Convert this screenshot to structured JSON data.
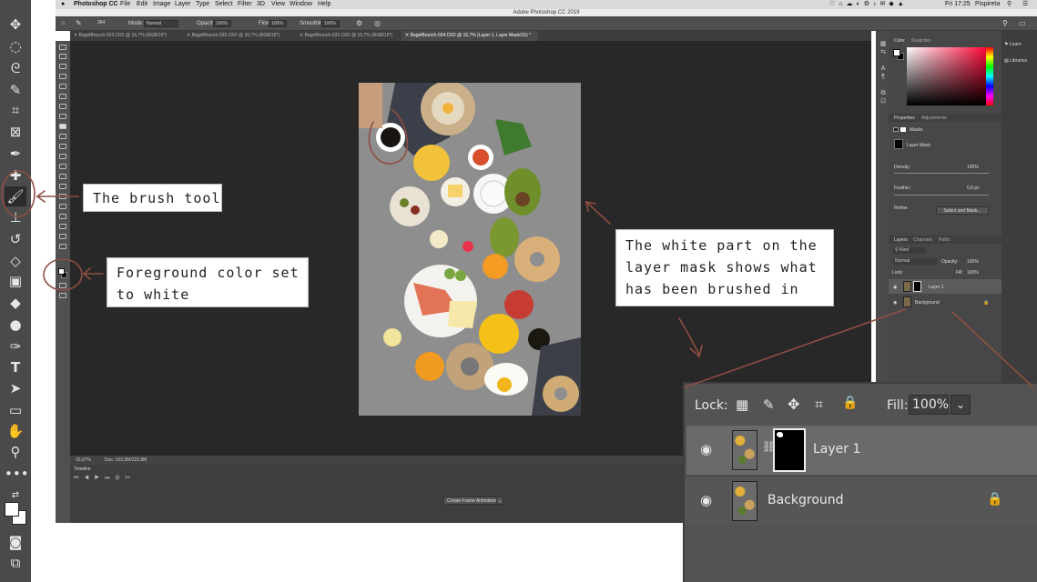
{
  "app": {
    "mac_menu": [
      "Photoshop CC",
      "File",
      "Edit",
      "Image",
      "Layer",
      "Type",
      "Select",
      "Filter",
      "3D",
      "View",
      "Window",
      "Help"
    ],
    "window_title": "Adobe Photoshop CC 2019",
    "clock": "Fri 17:25",
    "user": "Pispireta"
  },
  "options_bar": {
    "brush_size": "364",
    "mode_label": "Mode:",
    "mode_value": "Normal",
    "opacity_label": "Opacity:",
    "opacity_value": "100%",
    "flow_label": "Flow:",
    "flow_value": "100%",
    "smoothing_label": "Smoothing:",
    "smoothing_value": "100%"
  },
  "tabs": [
    "BagelBrunch-023.CR2 @ 16,7% (RGB/16*)",
    "BagelBrunch-030.CR2 @ 16,7% (RGB/16*)",
    "BagelBrunch-031.CR2 @ 16,7% (RGB/16*)",
    "BagelBrunch-034.CR2 @ 16,7% (Layer 1, Layer Mask/16) *"
  ],
  "status": {
    "zoom": "16,67%",
    "doc": "Doc: 102,5M/222,8M"
  },
  "timeline": {
    "title": "Timeline",
    "create_button": "Create Frame Animation"
  },
  "color_panel": {
    "tab1": "Color",
    "tab2": "Swatches"
  },
  "properties_panel": {
    "tab1": "Properties",
    "tab2": "Adjustments",
    "masks": "Masks",
    "layer_mask": "Layer Mask",
    "density_label": "Density:",
    "density_value": "100%",
    "feather_label": "Feather:",
    "feather_value": "0,0 px",
    "refine_label": "Refine:",
    "select_mask": "Select and Mask..."
  },
  "layers_panel_small": {
    "tab1": "Layers",
    "tab2": "Channels",
    "tab3": "Paths",
    "kind": "Kind",
    "blend": "Normal",
    "opacity_label": "Opacity:",
    "opacity_value": "100%",
    "lock_label": "Lock:",
    "fill_label": "Fill:",
    "fill_value": "100%",
    "layer1": "Layer 1",
    "background": "Background"
  },
  "right_rail": {
    "learn": "Learn",
    "libraries": "Libraries"
  },
  "callouts": {
    "brush": "The brush tool",
    "fg_line1": "Foreground color set",
    "fg_line2": "to white",
    "mask_line1": "The white part on the",
    "mask_line2": "layer mask shows what",
    "mask_line3": "has been brushed in"
  },
  "layers_zoom": {
    "lock_label": "Lock:",
    "fill_label": "Fill:",
    "fill_value": "100%",
    "layer1": "Layer 1",
    "background": "Background"
  },
  "colors": {
    "annotation": "#8e4e42",
    "ui_dark": "#282828",
    "ui_panel": "#474747"
  }
}
